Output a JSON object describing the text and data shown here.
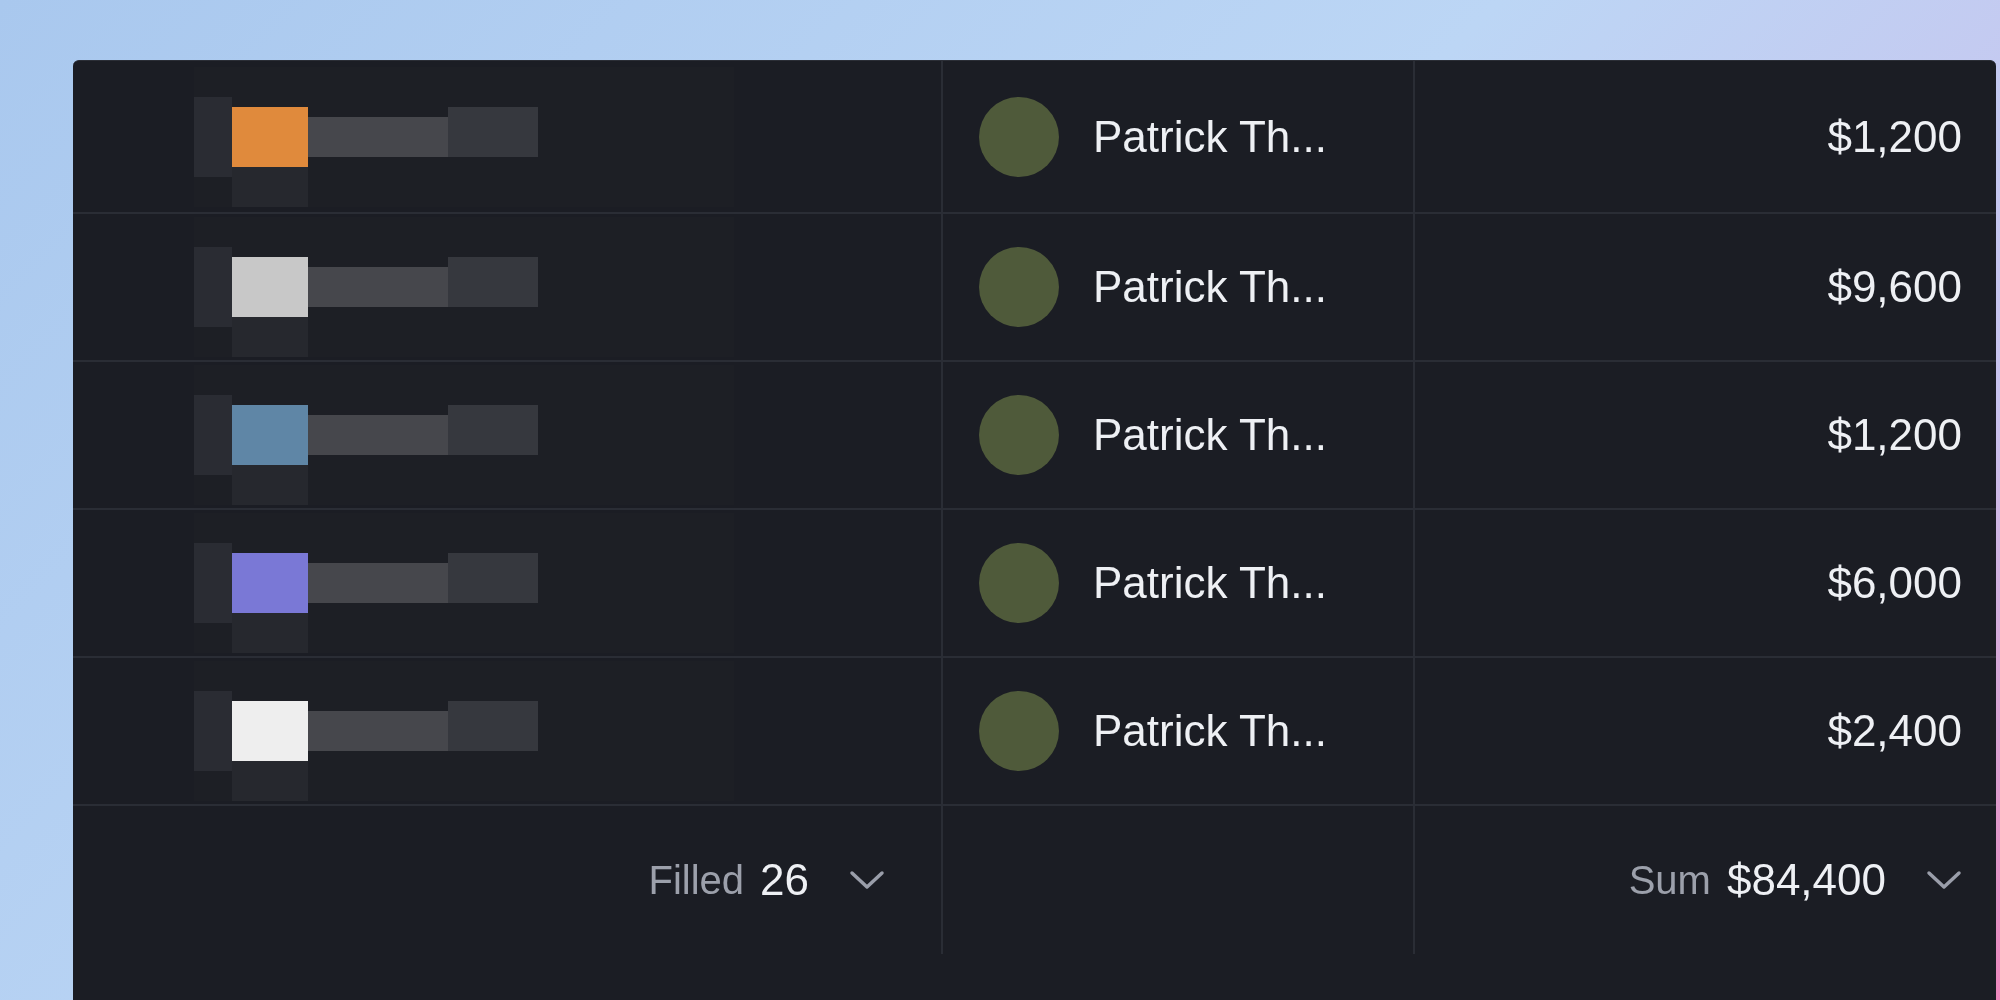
{
  "rows": [
    {
      "owner": "Patrick Th...",
      "amount": "$1,200"
    },
    {
      "owner": "Patrick Th...",
      "amount": "$9,600"
    },
    {
      "owner": "Patrick Th...",
      "amount": "$1,200"
    },
    {
      "owner": "Patrick Th...",
      "amount": "$6,000"
    },
    {
      "owner": "Patrick Th...",
      "amount": "$2,400"
    }
  ],
  "footer": {
    "filled_label": "Filled",
    "filled_value": "26",
    "sum_label": "Sum",
    "sum_value": "$84,400"
  }
}
